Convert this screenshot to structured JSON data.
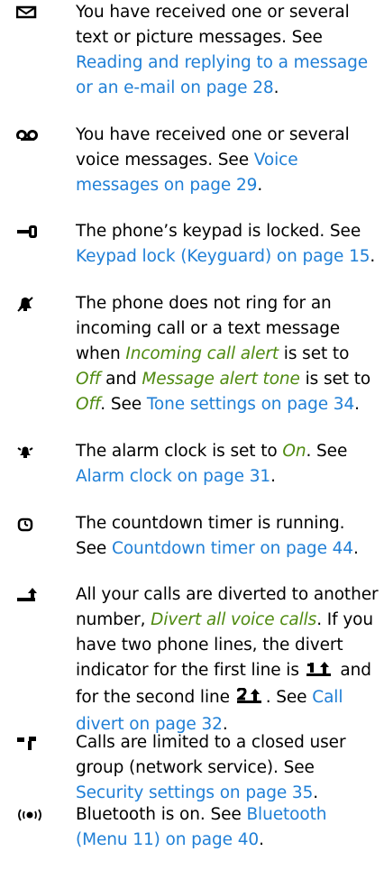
{
  "entries": [
    {
      "icon": "message-icon",
      "t1": "You have received one or several text or picture messages. See ",
      "link": "Reading and replying to a message or an e-mail on page 28",
      "t2": "."
    },
    {
      "icon": "voicemail-icon",
      "t1": "You have received one or several voice messages. See ",
      "link": "Voice messages on page 29",
      "t2": "."
    },
    {
      "icon": "key-lock-icon",
      "t1": "The phone’s keypad is locked. See ",
      "link": "Keypad lock (Keyguard) on page 15",
      "t2": "."
    },
    {
      "icon": "silent-icon",
      "t1": "The phone does not ring for an incoming call or a text message when ",
      "term1": "Incoming call alert",
      "t2": " is set to ",
      "term2": "Off",
      "t3": " and ",
      "term3": "Message alert tone",
      "t4": " is set to ",
      "term4": "Off",
      "t5": ". See ",
      "link": "Tone settings on page 34",
      "t6": "."
    },
    {
      "icon": "alarm-clock-icon",
      "t1": "The alarm clock is set to ",
      "term1": "On",
      "t2": ". See ",
      "link": "Alarm clock on page 31",
      "t3": "."
    },
    {
      "icon": "countdown-timer-icon",
      "t1": "The countdown timer is running. See ",
      "link": "Countdown timer on page 44",
      "t2": "."
    },
    {
      "icon": "call-divert-icon",
      "t1": "All your calls are diverted to another number, ",
      "term1": "Divert all voice calls",
      "t2": ". If you have two phone lines, the divert indicator for the first line is ",
      "t3": " and for the second line ",
      "t4": ". See ",
      "link": "Call divert on page 32",
      "t5": "."
    },
    {
      "icon": "closed-user-group-icon",
      "t1": "Calls are limited to a closed user group (network service). See ",
      "link": "Security settings on page 35",
      "t2": "."
    },
    {
      "icon": "bluetooth-icon",
      "t1": "Bluetooth is on. See ",
      "link": "Bluetooth (Menu 11) on page 40",
      "t2": "."
    }
  ]
}
